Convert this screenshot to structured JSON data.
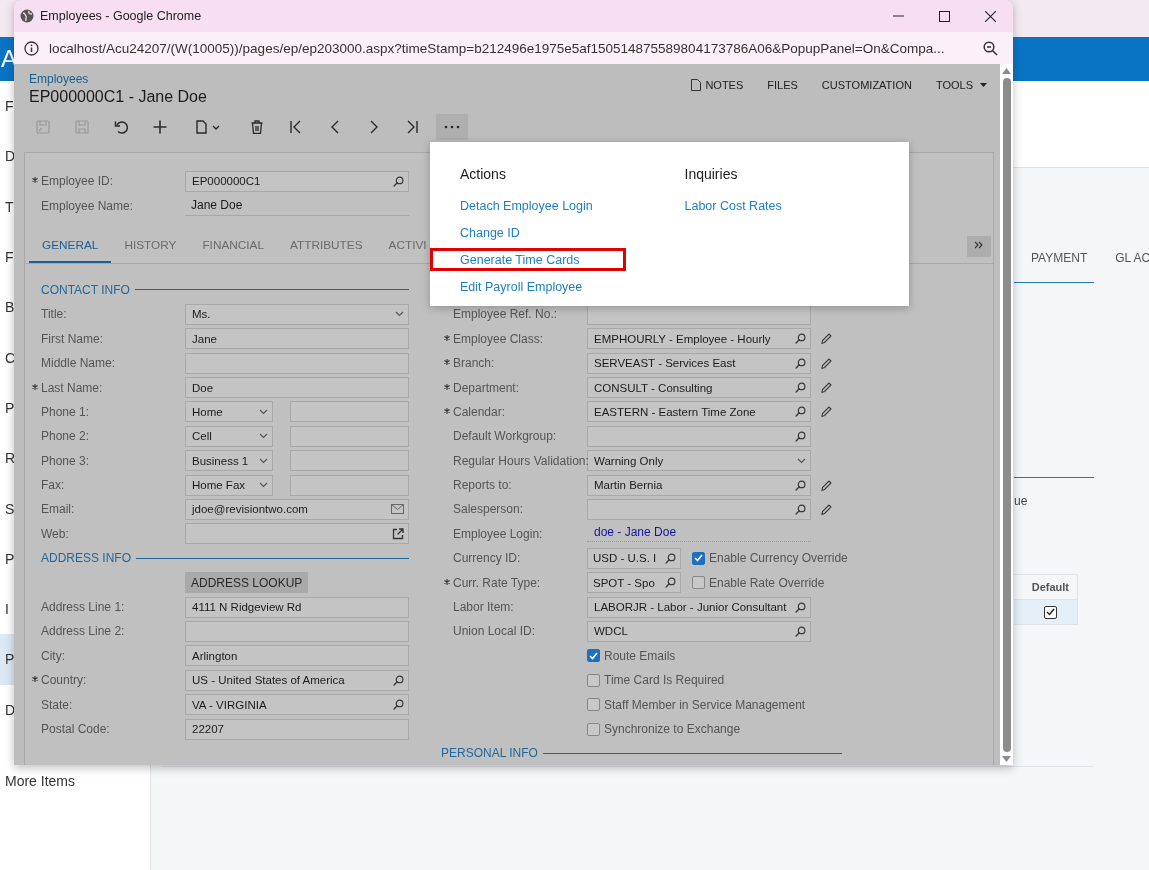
{
  "background": {
    "logo_text": "A",
    "sidebar_items": [
      {
        "label": "F",
        "selected": false
      },
      {
        "label": "D",
        "selected": false
      },
      {
        "label": "T",
        "selected": false
      },
      {
        "label": "F",
        "selected": false
      },
      {
        "label": "B",
        "selected": false
      },
      {
        "label": "C",
        "selected": false
      },
      {
        "label": "P",
        "selected": false
      },
      {
        "label": "R",
        "selected": false
      },
      {
        "label": "S",
        "selected": false
      },
      {
        "label": "P",
        "selected": false
      },
      {
        "label": "I",
        "selected": false
      },
      {
        "label": "P",
        "selected": true
      },
      {
        "label": "D",
        "selected": false
      }
    ],
    "more_items": "More Items",
    "tabs": [
      "PAYMENT",
      "GL AC"
    ],
    "fragment": "ue",
    "table": {
      "columns": [
        "Default"
      ],
      "rows": [
        {
          "checked": true
        }
      ]
    }
  },
  "window": {
    "title": "Employees - Google Chrome",
    "url": "localhost/Acu24207/(W(10005))/pages/ep/ep203000.aspx?timeStamp=b212496e1975e5af150514875589804173786A06&PopupPanel=On&Compa..."
  },
  "page": {
    "breadcrumb": "Employees",
    "title": "EP000000C1 - Jane Doe",
    "header_actions": [
      {
        "label": "NOTES",
        "kind": "notes"
      },
      {
        "label": "FILES",
        "kind": "plain"
      },
      {
        "label": "CUSTOMIZATION",
        "kind": "plain"
      },
      {
        "label": "TOOLS",
        "kind": "dropdown"
      }
    ],
    "toolbar": [
      {
        "kind": "save-close",
        "disabled": true
      },
      {
        "kind": "save",
        "disabled": true
      },
      {
        "kind": "undo",
        "disabled": false
      },
      {
        "kind": "add",
        "disabled": false
      },
      {
        "kind": "copy",
        "disabled": false
      },
      {
        "kind": "delete",
        "disabled": false
      },
      {
        "kind": "first",
        "disabled": false
      },
      {
        "kind": "prev",
        "disabled": false
      },
      {
        "kind": "next",
        "disabled": false
      },
      {
        "kind": "last",
        "disabled": false
      },
      {
        "kind": "more",
        "disabled": false,
        "expanded": true
      }
    ],
    "summary": [
      {
        "kind": "lookup",
        "label": "Employee ID:",
        "required": true,
        "value": "EP000000C1"
      },
      {
        "kind": "plain",
        "label": "Employee Name:",
        "required": false,
        "value": "Jane Doe"
      }
    ],
    "tabs": [
      {
        "label": "GENERAL",
        "selected": true
      },
      {
        "label": "HISTORY",
        "selected": false
      },
      {
        "label": "FINANCIAL",
        "selected": false
      },
      {
        "label": "ATTRIBUTES",
        "selected": false
      },
      {
        "label": "ACTIVI",
        "selected": false
      }
    ],
    "left_column": [
      {
        "kind": "section",
        "label": "CONTACT INFO"
      },
      {
        "kind": "select",
        "label": "Title:",
        "required": false,
        "value": "Ms."
      },
      {
        "kind": "text",
        "label": "First Name:",
        "required": false,
        "value": "Jane"
      },
      {
        "kind": "text",
        "label": "Middle Name:",
        "required": false
      },
      {
        "kind": "text",
        "label": "Last Name:",
        "required": true,
        "value": "Doe"
      },
      {
        "kind": "phone",
        "label": "Phone 1:",
        "required": false,
        "value": "Home"
      },
      {
        "kind": "phone",
        "label": "Phone 2:",
        "required": false,
        "value": "Cell"
      },
      {
        "kind": "phone",
        "label": "Phone 3:",
        "required": false,
        "value": "Business 1"
      },
      {
        "kind": "phone",
        "label": "Fax:",
        "required": false,
        "value": "Home Fax"
      },
      {
        "kind": "email",
        "label": "Email:",
        "required": false,
        "value": "jdoe@revisiontwo.com"
      },
      {
        "kind": "url",
        "label": "Web:",
        "required": false
      },
      {
        "kind": "section",
        "label": "ADDRESS INFO"
      },
      {
        "kind": "button",
        "label": "ADDRESS LOOKUP"
      },
      {
        "kind": "text",
        "label": "Address Line 1:",
        "required": false,
        "value": "4111 N Ridgeview Rd"
      },
      {
        "kind": "text",
        "label": "Address Line 2:",
        "required": false
      },
      {
        "kind": "text",
        "label": "City:",
        "required": false,
        "value": "Arlington"
      },
      {
        "kind": "lookup",
        "label": "Country:",
        "required": true,
        "value": "US - United States of America"
      },
      {
        "kind": "lookup",
        "label": "State:",
        "required": false,
        "value": "VA - VIRGINIA"
      },
      {
        "kind": "text",
        "label": "Postal Code:",
        "required": false,
        "value": "22207"
      }
    ],
    "right_column": [
      {
        "kind": "text",
        "label": "Employee Ref. No.:",
        "required": false
      },
      {
        "kind": "lookup",
        "label": "Employee Class:",
        "required": true,
        "value": "EMPHOURLY - Employee - Hourly",
        "edit_icon": true
      },
      {
        "kind": "lookup",
        "label": "Branch:",
        "required": true,
        "value": "SERVEAST - Services East",
        "edit_icon": true
      },
      {
        "kind": "lookup",
        "label": "Department:",
        "required": true,
        "value": "CONSULT - Consulting",
        "edit_icon": true
      },
      {
        "kind": "lookup",
        "label": "Calendar:",
        "required": true,
        "value": "EASTERN - Eastern Time Zone",
        "edit_icon": true
      },
      {
        "kind": "lookup",
        "label": "Default Workgroup:",
        "required": false,
        "edit_icon": false
      },
      {
        "kind": "select",
        "label": "Regular Hours Validation:",
        "required": false,
        "value": "Warning Only"
      },
      {
        "kind": "lookup",
        "label": "Reports to:",
        "required": false,
        "value": "Martin Bernia",
        "edit_icon": true
      },
      {
        "kind": "lookup",
        "label": "Salesperson:",
        "required": false,
        "edit_icon": true
      },
      {
        "kind": "link",
        "label": "Employee Login:",
        "required": false,
        "value": "doe - Jane Doe"
      },
      {
        "kind": "short-lookup",
        "label": "Currency ID:",
        "required": false,
        "value": "USD - U.S. I",
        "check_label": "Enable Currency Override",
        "checked": true
      },
      {
        "kind": "short-lookup",
        "label": "Curr. Rate Type:",
        "required": true,
        "value": "SPOT - Spo",
        "check_label": "Enable Rate Override",
        "checked": false
      },
      {
        "kind": "lookup",
        "label": "Labor Item:",
        "required": false,
        "value": "LABORJR - Labor - Junior Consultant",
        "edit_icon": false
      },
      {
        "kind": "lookup",
        "label": "Union Local ID:",
        "required": false,
        "value": "WDCL",
        "edit_icon": false
      },
      {
        "kind": "checkbox",
        "label": "Route Emails",
        "checked": true
      },
      {
        "kind": "checkbox",
        "label": "Time Card Is Required",
        "checked": false
      },
      {
        "kind": "checkbox",
        "label": "Staff Member in Service Management",
        "checked": false
      },
      {
        "kind": "checkbox",
        "label": "Synchronize to Exchange",
        "checked": false
      },
      {
        "kind": "section",
        "label": "PERSONAL INFO"
      }
    ],
    "menu": {
      "columns": [
        {
          "heading": "Actions",
          "items": [
            {
              "label": "Detach Employee Login",
              "highlighted": false
            },
            {
              "label": "Change ID",
              "highlighted": false
            },
            {
              "label": "Generate Time Cards",
              "highlighted": true
            },
            {
              "label": "Edit Payroll Employee",
              "highlighted": false
            }
          ]
        },
        {
          "heading": "Inquiries",
          "items": [
            {
              "label": "Labor Cost Rates",
              "highlighted": false
            }
          ]
        }
      ]
    }
  }
}
